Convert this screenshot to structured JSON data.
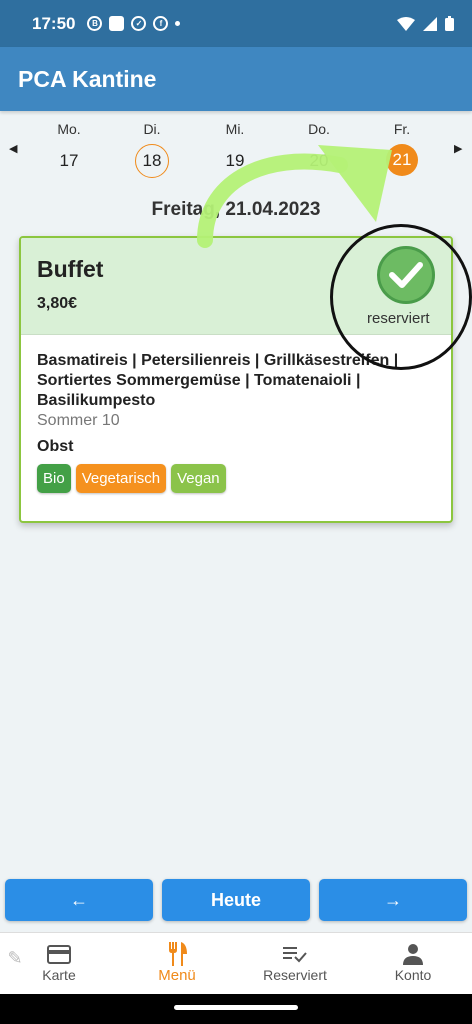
{
  "status": {
    "time": "17:50",
    "icons": [
      "b-badge-icon",
      "notification-box-icon",
      "check-circle-icon",
      "facebook-icon",
      "dot-icon",
      "wifi-icon",
      "signal-icon",
      "battery-icon"
    ]
  },
  "app": {
    "title": "PCA Kantine"
  },
  "week": {
    "days": [
      {
        "name": "Mo.",
        "num": "17"
      },
      {
        "name": "Di.",
        "num": "18"
      },
      {
        "name": "Mi.",
        "num": "19"
      },
      {
        "name": "Do.",
        "num": "20"
      },
      {
        "name": "Fr.",
        "num": "21"
      }
    ],
    "today_index": 1,
    "selected_index": 4
  },
  "date_title": "Freitag, 21.04.2023",
  "meal": {
    "name": "Buffet",
    "price": "3,80€",
    "status": "reserviert",
    "description": "Basmatireis | Petersilienreis | Grillkäsestreifen | Sortiertes Sommergemüse | Tomatenaioli | Basilikumpesto",
    "subtitle": "Sommer 10",
    "side": "Obst",
    "tags": [
      {
        "label": "Bio",
        "color": "#43a046"
      },
      {
        "label": "Vegetarisch",
        "color": "#f5911e"
      },
      {
        "label": "Vegan",
        "color": "#8bc34a"
      }
    ]
  },
  "nav": {
    "prev": "←",
    "today": "Heute",
    "next": "→"
  },
  "tabs": [
    {
      "label": "Karte",
      "icon": "card-icon"
    },
    {
      "label": "Menü",
      "icon": "cutlery-icon"
    },
    {
      "label": "Reserviert",
      "icon": "reserved-list-icon"
    },
    {
      "label": "Konto",
      "icon": "person-icon"
    }
  ],
  "colors": {
    "primary": "#3f87c1",
    "accent": "#f08a1a",
    "button": "#2b8ee6",
    "card_border": "#8cc63f"
  }
}
